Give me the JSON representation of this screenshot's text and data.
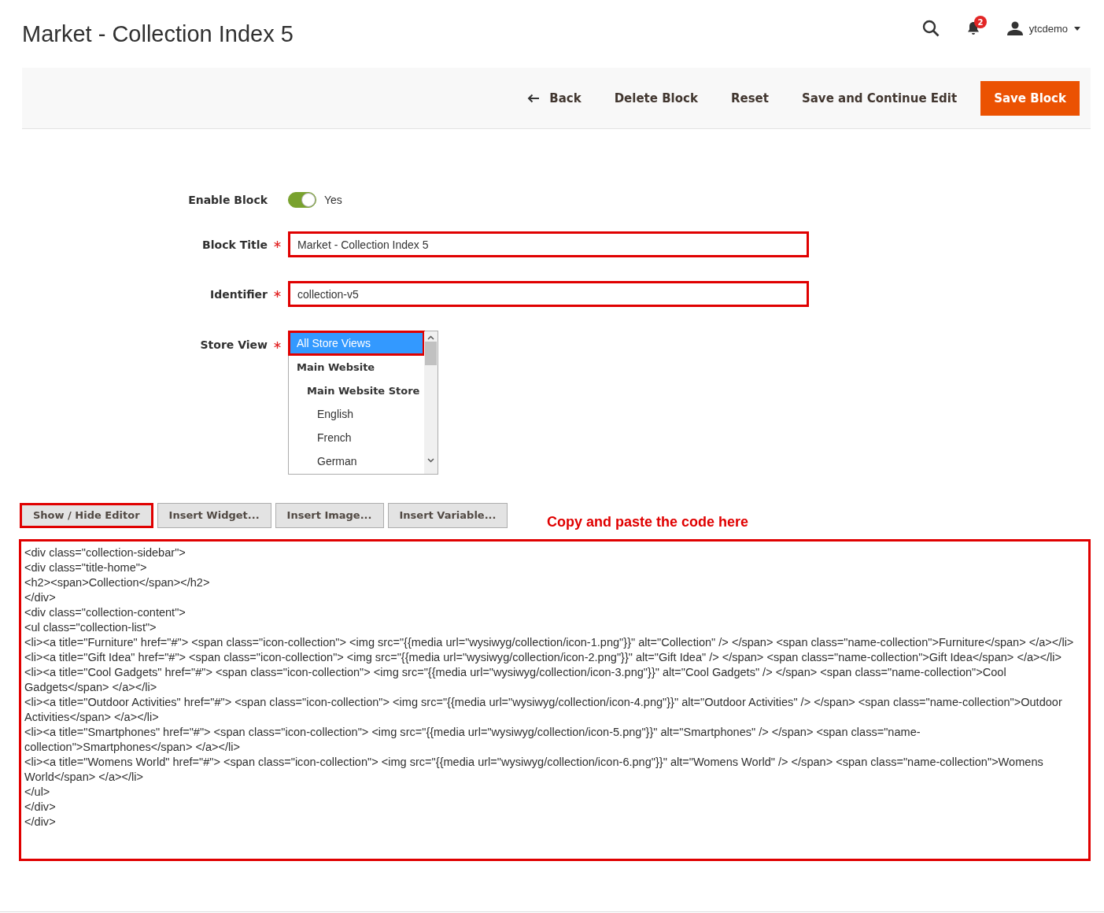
{
  "page_title": "Market - Collection Index 5",
  "header": {
    "notifications": "2",
    "user": "ytcdemo"
  },
  "toolbar": {
    "back": "Back",
    "buttons": [
      {
        "label": "Delete Block",
        "kind": "plain"
      },
      {
        "label": "Reset",
        "kind": "plain"
      },
      {
        "label": "Save and Continue Edit",
        "kind": "plain"
      },
      {
        "label": "Save Block",
        "kind": "primary"
      }
    ]
  },
  "form": {
    "enable": {
      "label": "Enable Block",
      "on": true,
      "value": "Yes"
    },
    "fields": [
      {
        "label": "Block Title",
        "required": true,
        "value": "Market - Collection Index 5",
        "highlighted": true
      },
      {
        "label": "Identifier",
        "required": true,
        "value": "collection-v5",
        "highlighted": true
      }
    ],
    "store_view": {
      "label": "Store View",
      "required": true,
      "options": [
        {
          "label": "All Store Views",
          "selected": true,
          "highlighted": true,
          "kind": "option"
        },
        {
          "label": "Main Website",
          "selected": false,
          "highlighted": false,
          "kind": "group",
          "children": [
            {
              "label": "Main Website Store",
              "selected": false,
              "highlighted": false,
              "kind": "group",
              "children": [
                {
                  "label": "English",
                  "selected": false,
                  "highlighted": false,
                  "kind": "option"
                },
                {
                  "label": "French",
                  "selected": false,
                  "highlighted": false,
                  "kind": "option"
                },
                {
                  "label": "German",
                  "selected": false,
                  "highlighted": false,
                  "kind": "option"
                }
              ]
            }
          ]
        }
      ]
    }
  },
  "editor": {
    "buttons": [
      {
        "label": "Show / Hide Editor",
        "highlighted": true
      },
      {
        "label": "Insert Widget...",
        "highlighted": false
      },
      {
        "label": "Insert Image...",
        "highlighted": false
      },
      {
        "label": "Insert Variable...",
        "highlighted": false
      }
    ],
    "annotation": "Copy and paste the code here",
    "highlighted": true,
    "code_lines": [
      "<div class=\"collection-sidebar\">",
      "<div class=\"title-home\">",
      "<h2><span>Collection</span></h2>",
      "</div>",
      "<div class=\"collection-content\">",
      "<ul class=\"collection-list\">",
      "<li><a title=\"Furniture\" href=\"#\"> <span class=\"icon-collection\"> <img src=\"{{media url=\"wysiwyg/collection/icon-1.png\"}}\" alt=\"Collection\" /> </span> <span class=\"name-collection\">Furniture</span> </a></li>",
      "<li><a title=\"Gift Idea\" href=\"#\"> <span class=\"icon-collection\"> <img src=\"{{media url=\"wysiwyg/collection/icon-2.png\"}}\" alt=\"Gift Idea\" /> </span> <span class=\"name-collection\">Gift Idea</span> </a></li>",
      "<li><a title=\"Cool Gadgets\" href=\"#\"> <span class=\"icon-collection\"> <img src=\"{{media url=\"wysiwyg/collection/icon-3.png\"}}\" alt=\"Cool Gadgets\" /> </span> <span class=\"name-collection\">Cool Gadgets</span> </a></li>",
      "<li><a title=\"Outdoor Activities\" href=\"#\"> <span class=\"icon-collection\"> <img src=\"{{media url=\"wysiwyg/collection/icon-4.png\"}}\" alt=\"Outdoor Activities\" /> </span> <span class=\"name-collection\">Outdoor Activities</span> </a></li>",
      "<li><a title=\"Smartphones\" href=\"#\"> <span class=\"icon-collection\"> <img src=\"{{media url=\"wysiwyg/collection/icon-5.png\"}}\" alt=\"Smartphones\" /> </span> <span class=\"name-collection\">Smartphones</span> </a></li>",
      "<li><a title=\"Womens World\" href=\"#\"> <span class=\"icon-collection\"> <img src=\"{{media url=\"wysiwyg/collection/icon-6.png\"}}\" alt=\"Womens World\" /> </span> <span class=\"name-collection\">Womens World</span> </a></li>",
      "</ul>",
      "</div>",
      "</div>"
    ]
  }
}
